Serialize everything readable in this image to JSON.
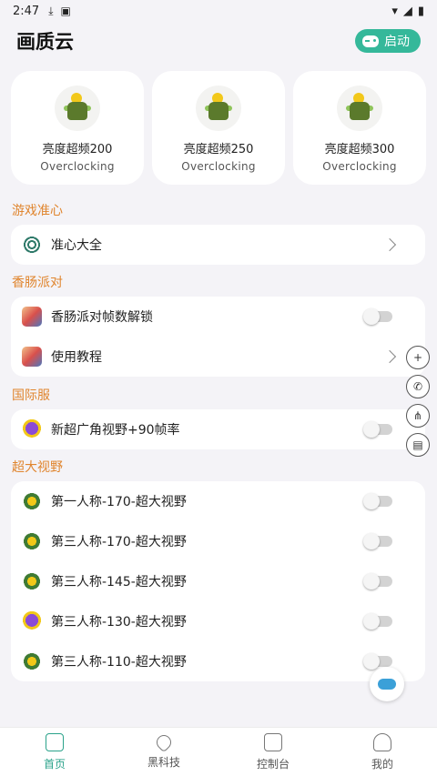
{
  "status_bar": {
    "time": "2:47"
  },
  "app": {
    "title": "画质云",
    "launch_label": "启动"
  },
  "cards": [
    {
      "name": "亮度超频200",
      "sub": "Overclocking"
    },
    {
      "name": "亮度超频250",
      "sub": "Overclocking"
    },
    {
      "name": "亮度超频300",
      "sub": "Overclocking"
    }
  ],
  "sections": {
    "crosshair": {
      "label": "游戏准心",
      "items": [
        {
          "label": "准心大全"
        }
      ]
    },
    "sausage": {
      "label": "香肠派对",
      "items": [
        {
          "label": "香肠派对帧数解锁"
        },
        {
          "label": "使用教程"
        }
      ]
    },
    "intl": {
      "label": "国际服",
      "items": [
        {
          "label": "新超广角视野+90帧率"
        }
      ]
    },
    "fov": {
      "label": "超大视野",
      "items": [
        {
          "label": "第一人称-170-超大视野"
        },
        {
          "label": "第三人称-170-超大视野"
        },
        {
          "label": "第三人称-145-超大视野"
        },
        {
          "label": "第三人称-130-超大视野"
        },
        {
          "label": "第三人称-110-超大视野"
        }
      ]
    }
  },
  "bottom_nav": [
    {
      "label": "首页"
    },
    {
      "label": "黑科技"
    },
    {
      "label": "控制台"
    },
    {
      "label": "我的"
    }
  ],
  "colors": {
    "accent": "#2aa28a",
    "section_label": "#e0852e",
    "launch_button": "#35b89a"
  }
}
